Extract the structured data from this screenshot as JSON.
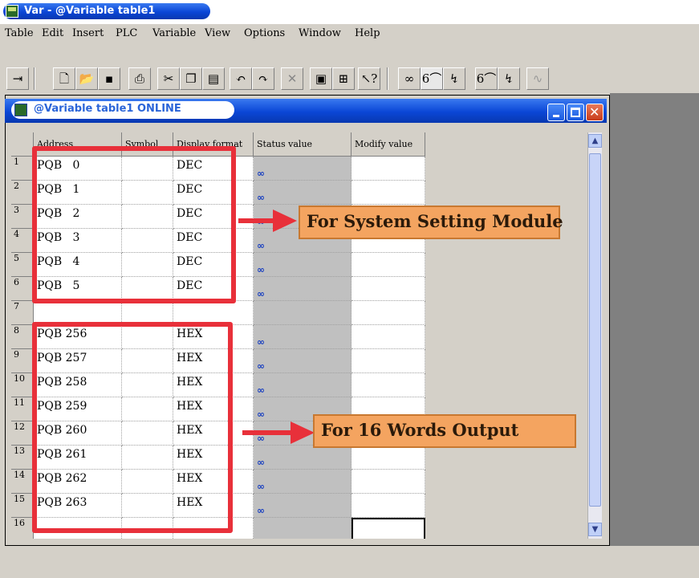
{
  "app_title": "Var - @Variable table1",
  "menu": [
    "Table",
    "Edit",
    "Insert",
    "PLC",
    "Variable",
    "View",
    "Options",
    "Window",
    "Help"
  ],
  "toolbar_icons": [
    "pin-icon",
    "new-icon",
    "open-icon",
    "save-icon",
    "print-icon",
    "cut-icon",
    "copy-icon",
    "paste-icon",
    "undo-icon",
    "redo-icon",
    "delete-icon",
    "monitor-icon",
    "network-icon",
    "help-cursor-icon",
    "glasses-icon",
    "trigger-icon",
    "modify-icon",
    "trigger-glasses-icon",
    "modify-trigger-icon",
    "disabled-icon"
  ],
  "child_window": {
    "title": "@Variable table1  ONLINE"
  },
  "columns": [
    "Address",
    "Symbol",
    "Display format",
    "Status value",
    "Modify value"
  ],
  "rows": [
    {
      "num": "1",
      "address": "PQB   0",
      "symbol": "",
      "format": "DEC",
      "status": "glasses"
    },
    {
      "num": "2",
      "address": "PQB   1",
      "symbol": "",
      "format": "DEC",
      "status": "glasses"
    },
    {
      "num": "3",
      "address": "PQB   2",
      "symbol": "",
      "format": "DEC",
      "status": "glasses"
    },
    {
      "num": "4",
      "address": "PQB   3",
      "symbol": "",
      "format": "DEC",
      "status": "glasses"
    },
    {
      "num": "5",
      "address": "PQB   4",
      "symbol": "",
      "format": "DEC",
      "status": "glasses"
    },
    {
      "num": "6",
      "address": "PQB   5",
      "symbol": "",
      "format": "DEC",
      "status": "glasses"
    },
    {
      "num": "7",
      "address": "",
      "symbol": "",
      "format": "",
      "status": ""
    },
    {
      "num": "8",
      "address": "PQB 256",
      "symbol": "",
      "format": "HEX",
      "status": "glasses"
    },
    {
      "num": "9",
      "address": "PQB 257",
      "symbol": "",
      "format": "HEX",
      "status": "glasses"
    },
    {
      "num": "10",
      "address": "PQB 258",
      "symbol": "",
      "format": "HEX",
      "status": "glasses"
    },
    {
      "num": "11",
      "address": "PQB 259",
      "symbol": "",
      "format": "HEX",
      "status": "glasses"
    },
    {
      "num": "12",
      "address": "PQB 260",
      "symbol": "",
      "format": "HEX",
      "status": "glasses"
    },
    {
      "num": "13",
      "address": "PQB 261",
      "symbol": "",
      "format": "HEX",
      "status": "glasses"
    },
    {
      "num": "14",
      "address": "PQB 262",
      "symbol": "",
      "format": "HEX",
      "status": "glasses"
    },
    {
      "num": "15",
      "address": "PQB 263",
      "symbol": "",
      "format": "HEX",
      "status": "glasses"
    },
    {
      "num": "16",
      "address": "",
      "symbol": "",
      "format": "",
      "status": ""
    }
  ],
  "annotations": {
    "system_setting": "For System Setting Module",
    "words_output": "For 16 Words Output"
  },
  "colors": {
    "highlight": "#e8303a",
    "callout": "#f4a460",
    "titlebar": "#0a46d6"
  }
}
